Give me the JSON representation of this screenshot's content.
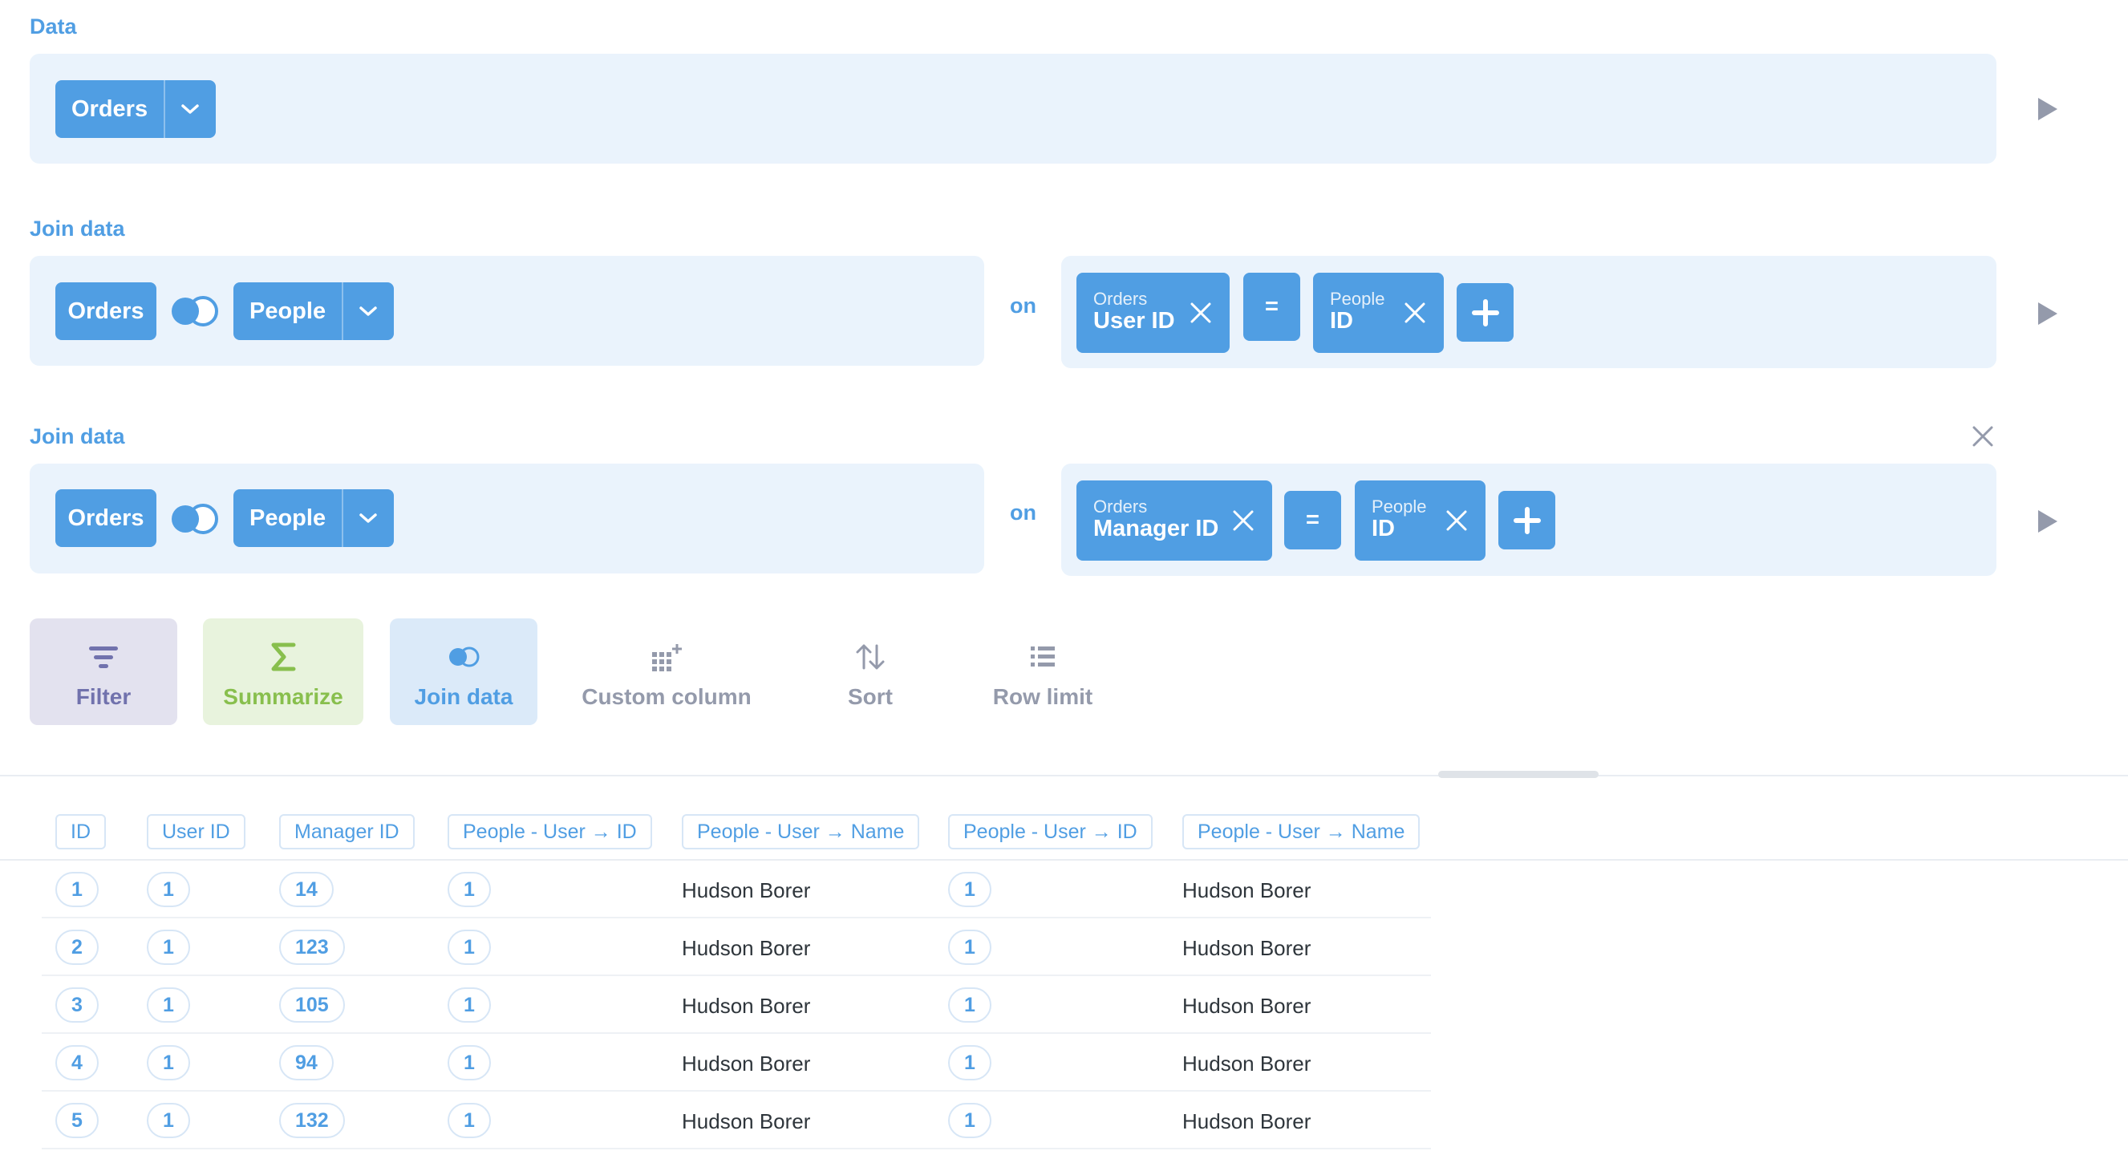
{
  "data_step": {
    "title": "Data",
    "source_label": "Orders"
  },
  "joins": [
    {
      "title": "Join data",
      "left_table": "Orders",
      "right_table": "People",
      "on_label": "on",
      "left_col": {
        "table": "Orders",
        "name": "User ID"
      },
      "operator": "=",
      "right_col": {
        "table": "People",
        "name": "ID"
      }
    },
    {
      "title": "Join data",
      "left_table": "Orders",
      "right_table": "People",
      "on_label": "on",
      "left_col": {
        "table": "Orders",
        "name": "Manager ID"
      },
      "operator": "=",
      "right_col": {
        "table": "People",
        "name": "ID"
      }
    }
  ],
  "actions": [
    {
      "label": "Filter",
      "icon": "filter-icon"
    },
    {
      "label": "Summarize",
      "icon": "sigma-icon"
    },
    {
      "label": "Join data",
      "icon": "join-icon"
    },
    {
      "label": "Custom column",
      "icon": "grid-add-icon"
    },
    {
      "label": "Sort",
      "icon": "sort-arrows-icon"
    },
    {
      "label": "Row limit",
      "icon": "list-icon"
    }
  ],
  "table": {
    "columns": [
      "ID",
      "User ID",
      "Manager ID",
      "People - User → ID",
      "People - User → Name",
      "People - User → ID",
      "People - User → Name"
    ],
    "rows": [
      [
        "1",
        "1",
        "14",
        "1",
        "Hudson Borer",
        "1",
        "Hudson Borer"
      ],
      [
        "2",
        "1",
        "123",
        "1",
        "Hudson Borer",
        "1",
        "Hudson Borer"
      ],
      [
        "3",
        "1",
        "105",
        "1",
        "Hudson Borer",
        "1",
        "Hudson Borer"
      ],
      [
        "4",
        "1",
        "94",
        "1",
        "Hudson Borer",
        "1",
        "Hudson Borer"
      ],
      [
        "5",
        "1",
        "132",
        "1",
        "Hudson Borer",
        "1",
        "Hudson Borer"
      ]
    ]
  },
  "colors": {
    "brand": "#509ee3",
    "step_bg": "#eaf3fc",
    "filter": "#7172ad",
    "summarize": "#88bf4d",
    "muted": "#949aab"
  }
}
